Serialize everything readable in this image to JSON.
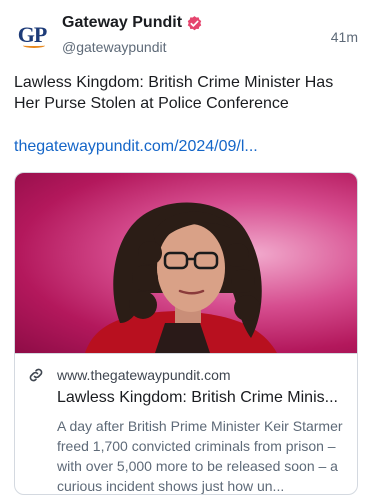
{
  "author": {
    "avatar_text": "GP",
    "display_name": "Gateway Pundit",
    "handle": "@gatewaypundit",
    "verified_icon": "verified-badge-icon",
    "verified_color": "#e5456e"
  },
  "post": {
    "timestamp": "41m",
    "text": "Lawless Kingdom: British Crime Minister Has Her Purse Stolen at Police Conference",
    "link_text": "thegatewaypundit.com/2024/09/l..."
  },
  "card": {
    "domain": "www.thegatewaypundit.com",
    "title": "Lawless Kingdom: British Crime Minis...",
    "description": "A day after British Prime Minister Keir Starmer freed 1,700 convicted criminals from prison – with over 5,000 more to be released soon – a curious incident shows just how un...",
    "link_icon": "link-icon"
  },
  "colors": {
    "link": "#1566c8",
    "muted": "#5e6a78",
    "brand_navy": "#1d3b78",
    "brand_orange": "#e8891f"
  }
}
